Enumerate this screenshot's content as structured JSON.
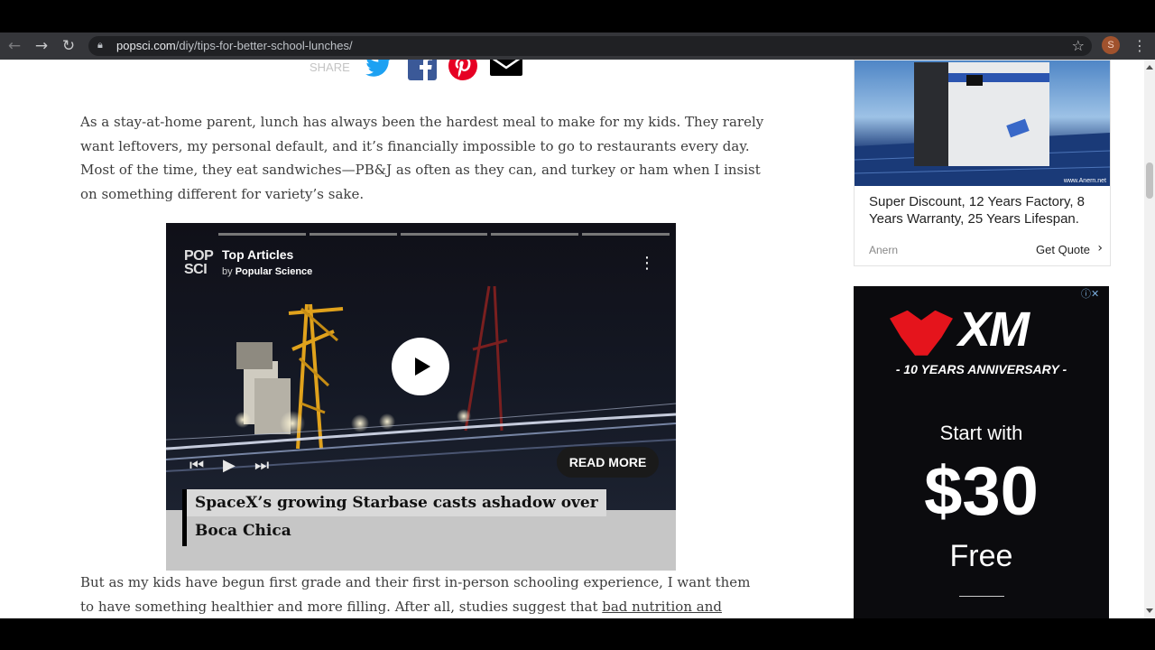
{
  "browser": {
    "url_host": "popsci.com",
    "url_path": "/diy/tips-for-better-school-lunches/",
    "profile_initial": "S"
  },
  "share": {
    "label": "SHARE",
    "icons": [
      "twitter-icon",
      "facebook-icon",
      "pinterest-icon",
      "email-icon"
    ]
  },
  "article": {
    "paragraph1": "As a stay-at-home parent, lunch has always been the hardest meal to make for my kids. They rarely want leftovers, my personal default, and it’s financially impossible to go to restaurants every day. Most of the time, they eat sandwiches—PB&J as often as they can, and turkey or ham when I insist on something different for variety’s sake.",
    "paragraph2_start": "But as my kids have begun first grade and their first in-person schooling experience, I want them to have something healthier and more filling. After all, studies suggest that ",
    "paragraph2_link": "bad nutrition and hunger are"
  },
  "video": {
    "logo": "POP SCI",
    "title": "Top Articles",
    "by_prefix": "by",
    "by_name": "Popular Science",
    "read_more": "READ MORE",
    "caption_line1": "SpaceX’s growing Starbase casts ashadow over",
    "caption_line2": "Boca Chica",
    "segments": 5
  },
  "ads": {
    "anern": {
      "description": "Super Discount, 12 Years Factory, 8 Years Warranty, 25 Years Lifespan.",
      "brand": "Anern",
      "cta": "Get Quote",
      "watermark": "www.Anern.net"
    },
    "xm": {
      "logo": "XM",
      "anniversary": "- 10 YEARS ANNIVERSARY -",
      "start": "Start with",
      "amount": "$30",
      "free": "Free"
    }
  },
  "colors": {
    "chrome_bg": "#35363a",
    "twitter": "#1da1f2",
    "facebook": "#3b5998",
    "pinterest": "#e60023",
    "xm_red": "#e5141c"
  }
}
